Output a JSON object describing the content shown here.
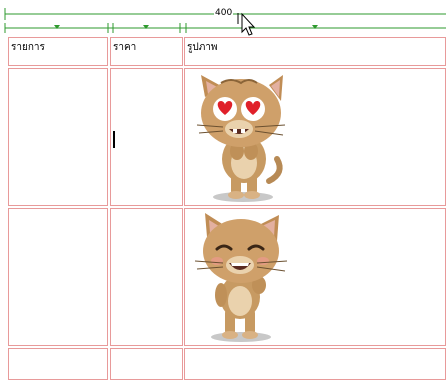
{
  "ruler": {
    "table_width": "400"
  },
  "table": {
    "headers": [
      "รายการ",
      "ราคา",
      "รูปภาพ"
    ]
  },
  "rows": [
    {
      "image": "cat-heart-eyes"
    },
    {
      "image": "cat-laughing"
    }
  ],
  "colors": {
    "cell_border": "#e89a9a",
    "ruler": "#2e9a2e"
  }
}
